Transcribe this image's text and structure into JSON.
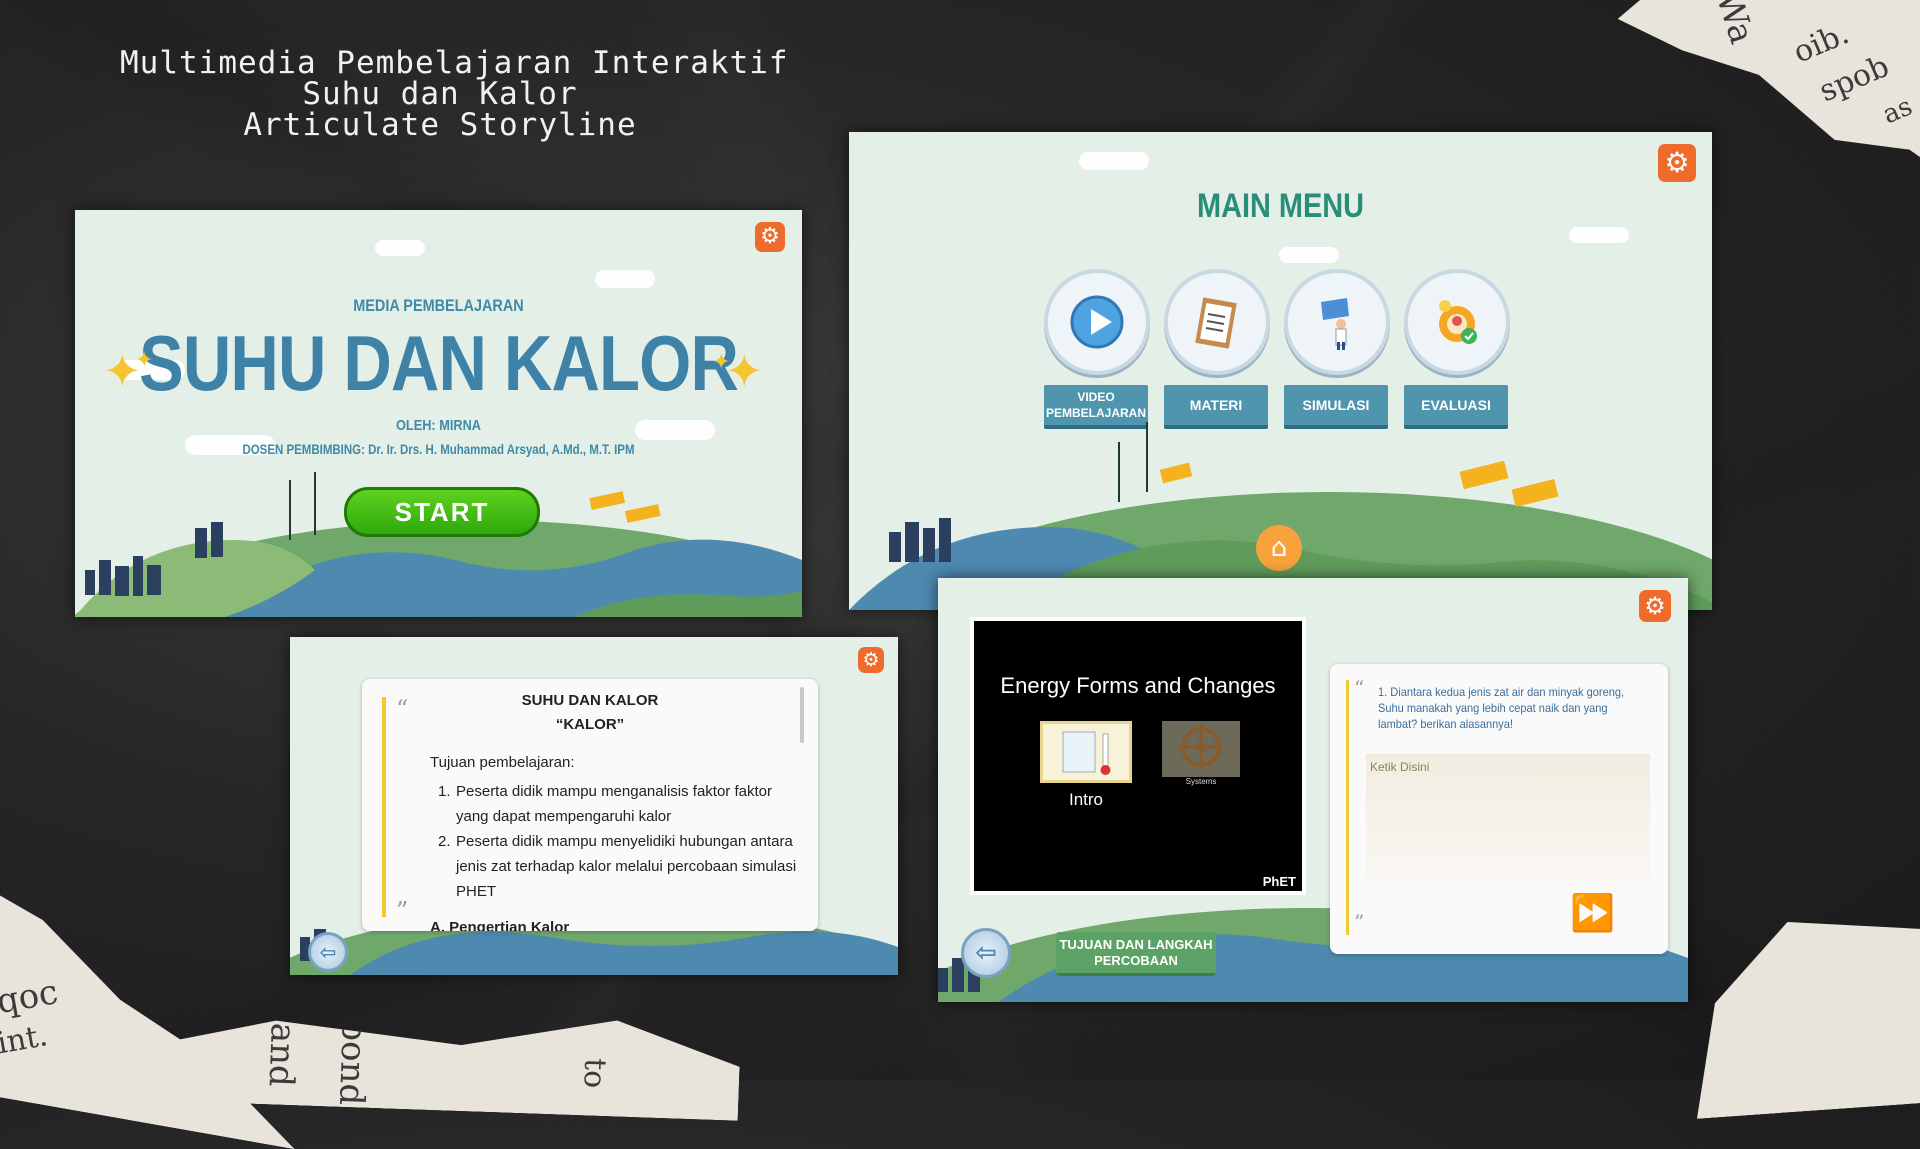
{
  "page": {
    "title_lines": [
      "Multimedia Pembelajaran Interaktif",
      "Suhu dan Kalor",
      "Articulate Storyline"
    ]
  },
  "colors": {
    "accent_orange": "#ef6b2b",
    "title_blue": "#3f82a8",
    "menu_green": "#2a8d78",
    "start_green": "#3cbf14",
    "panel_bg": "#e3efe7"
  },
  "newspaper": {
    "top_right": [
      "Wa",
      "oib.",
      "spob",
      "as"
    ],
    "bottom_left": [
      "aqoc",
      "oint."
    ],
    "bottom_middle": [
      "and",
      "pond",
      "to"
    ]
  },
  "slide_cover": {
    "subtitle": "MEDIA PEMBELAJARAN",
    "title": "SUHU DAN KALOR",
    "author": "OLEH: MIRNA",
    "supervisor": "DOSEN PEMBIMBING: Dr. Ir. Drs. H. Muhammad Arsyad, A.Md., M.T. IPM",
    "start_label": "START",
    "settings_icon": "gear-icon"
  },
  "slide_menu": {
    "title": "MAIN MENU",
    "items": [
      {
        "label": "VIDEO PEMBELAJARAN",
        "icon": "play-icon"
      },
      {
        "label": "MATERI",
        "icon": "clipboard-icon"
      },
      {
        "label": "SIMULASI",
        "icon": "presenter-icon"
      },
      {
        "label": "EVALUASI",
        "icon": "idea-check-icon"
      }
    ],
    "home_icon": "home-icon"
  },
  "slide_material": {
    "heading": "SUHU DAN KALOR",
    "subheading": "“KALOR”",
    "objective_title": "Tujuan pembelajaran:",
    "objectives": [
      {
        "num": "1.",
        "text": "Peserta didik mampu menganalisis faktor faktor yang dapat mempengaruhi kalor"
      },
      {
        "num": "2.",
        "text": "Peserta didik mampu menyelidiki hubungan antara jenis zat terhadap kalor melalui percobaan simulasi PHET"
      }
    ],
    "next_section": "A.  Pengertian Kalor",
    "back_icon": "arrow-left-icon"
  },
  "slide_simulation": {
    "sim_title": "Energy Forms and Changes",
    "screens": [
      {
        "label": "Intro",
        "icon": "beaker-thermometer-icon"
      },
      {
        "label": "Systems",
        "icon": "ship-wheel-icon"
      }
    ],
    "phet_logo": "PhET",
    "question": "1. Diantara kedua jenis zat air dan minyak goreng, Suhu manakah yang lebih cepat naik dan yang lambat? berikan alasannya!",
    "answer_placeholder": "Ketik Disini",
    "tujuan_button": "TUJUAN DAN LANGKAH PERCOBAAN",
    "next_icon": "fast-forward-icon",
    "back_icon": "arrow-left-icon"
  }
}
